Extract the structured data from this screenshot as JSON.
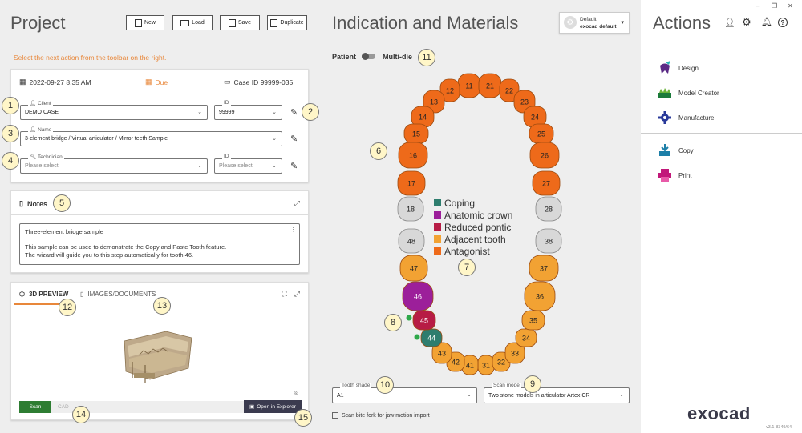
{
  "project": {
    "title": "Project",
    "toolbar": {
      "new": "New",
      "load": "Load",
      "save": "Save",
      "duplicate": "Duplicate"
    },
    "hint": "Select the next action from the toolbar on the right."
  },
  "case": {
    "datetime": "2022-09-27 8.35 AM",
    "due": "Due",
    "case_id": "Case ID 99999-035",
    "client_label": "Client",
    "client_value": "DEMO CASE",
    "client_id_label": "ID",
    "client_id_value": "99999",
    "name_label": "Name",
    "name_value": "3-element bridge / Virtual articulator / Mirror teeth,Sample",
    "technician_label": "Technician",
    "technician_placeholder": "Please select",
    "technician_id_label": "ID",
    "technician_id_placeholder": "Please select"
  },
  "notes": {
    "title": "Notes",
    "line1": "Three-element bridge sample",
    "line2": "This sample can be used to demonstrate the Copy and Paste Tooth feature.",
    "line3": "The wizard will guide you to this step automatically for tooth 46."
  },
  "preview": {
    "tab_3d": "3D PREVIEW",
    "tab_images": "IMAGES/DOCUMENTS",
    "scan": "Scan",
    "cad": "CAD",
    "open_explorer": "Open in Explorer"
  },
  "indication": {
    "title": "Indication and Materials",
    "profile_line1": "Default",
    "profile_line2": "exocad default",
    "patient": "Patient",
    "multi_die": "Multi-die",
    "legend": [
      {
        "label": "Coping",
        "color": "#2e7d6e"
      },
      {
        "label": "Anatomic crown",
        "color": "#9c1f9a"
      },
      {
        "label": "Reduced pontic",
        "color": "#b71c45"
      },
      {
        "label": "Adjacent tooth",
        "color": "#f2a233"
      },
      {
        "label": "Antagonist",
        "color": "#ee6a1a"
      }
    ],
    "tooth_shade_label": "Tooth shade",
    "tooth_shade_value": "A1",
    "scan_mode_label": "Scan mode",
    "scan_mode_value": "Two stone models in articulator Artex CR",
    "scan_bite_fork": "Scan bite fork for jaw motion import"
  },
  "teeth": {
    "upper": [
      "11",
      "12",
      "13",
      "14",
      "15",
      "16",
      "17",
      "18",
      "21",
      "22",
      "23",
      "24",
      "25",
      "26",
      "27",
      "28"
    ],
    "lower": [
      "31",
      "32",
      "33",
      "34",
      "35",
      "36",
      "37",
      "38",
      "41",
      "42",
      "43",
      "44",
      "45",
      "46",
      "47",
      "48"
    ]
  },
  "actions": {
    "title": "Actions",
    "items": [
      "Design",
      "Model Creator",
      "Manufacture",
      "Copy",
      "Print"
    ]
  },
  "brand": {
    "logo": "exocad",
    "version": "v3.1-8349/64"
  },
  "badges": [
    "1",
    "2",
    "3",
    "4",
    "5",
    "6",
    "7",
    "8",
    "9",
    "10",
    "11",
    "12",
    "13",
    "14",
    "15"
  ],
  "colors": {
    "accent": "#e8873a",
    "antagonist": "#ee6a1a",
    "adjacent": "#f2a233",
    "scan_green": "#2e7d32",
    "dark_button": "#3b3b4f"
  }
}
